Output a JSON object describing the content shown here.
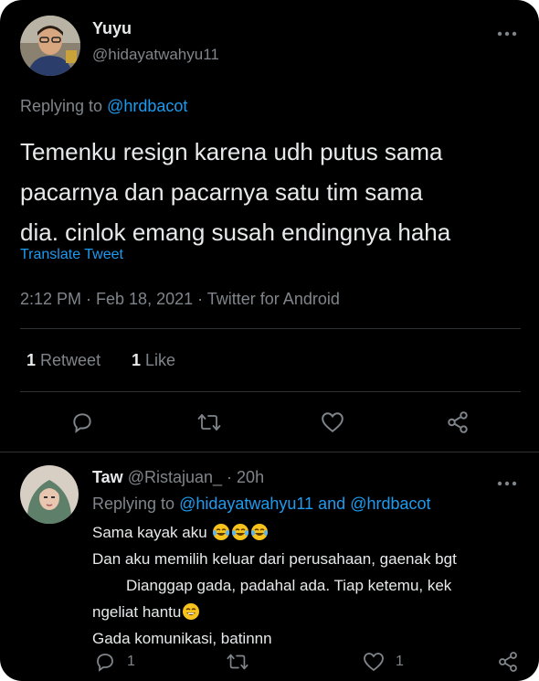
{
  "main_tweet": {
    "display_name": "Yuyu",
    "handle": "@hidayatwahyu11",
    "replying_prefix": "Replying to",
    "replying_to": "@hrdbacot",
    "text_lines": [
      "Temenku resign karena udh putus sama",
      "pacarnya dan pacarnya satu tim sama",
      "dia. cinlok emang susah endingnya haha"
    ],
    "translate": "Translate Tweet",
    "timestamp": "2:12 PM · Feb 18, 2021 · Twitter for Android",
    "retweet_count": "1",
    "retweet_label": "Retweet",
    "like_count": "1",
    "like_label": "Like",
    "more_icon": "more-dots-icon"
  },
  "reply_tweet": {
    "display_name": "Taw",
    "handle": "@Ristajuan_",
    "separator": "·",
    "time": "20h",
    "replying_prefix": "Replying to",
    "replying_to_1": "@hidayatwahyu11",
    "replying_and": "and",
    "replying_to_2": "@hrdbacot",
    "line1": "Sama kayak aku",
    "line2": "Dan aku memilih keluar dari perusahaan, gaenak bgt",
    "line3": "Dianggap gada, padahal ada. Tiap ketemu, kek",
    "line4": "ngeliat hantu",
    "line5": "Gada komunikasi, batinnn",
    "reply_count": "1",
    "like_count": "1"
  },
  "colors": {
    "background": "#000000",
    "accent": "#1d9bf0",
    "muted": "#7f858a",
    "divider": "#2f3336"
  }
}
